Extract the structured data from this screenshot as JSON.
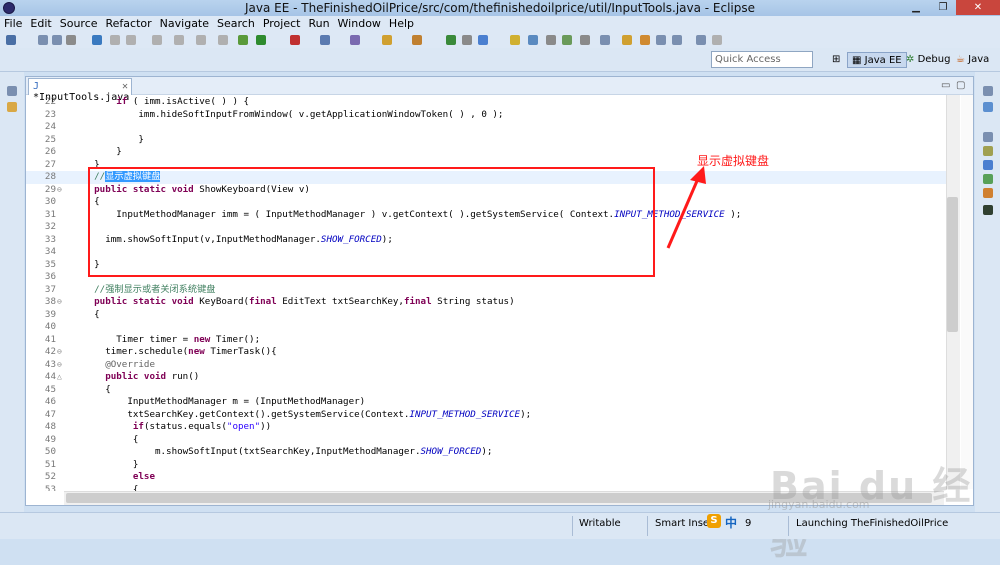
{
  "window": {
    "title": "Java EE - TheFinishedOilPrice/src/com/thefinishedoilprice/util/InputTools.java - Eclipse"
  },
  "menu": [
    "File",
    "Edit",
    "Source",
    "Refactor",
    "Navigate",
    "Search",
    "Project",
    "Run",
    "Window",
    "Help"
  ],
  "quick_access": {
    "placeholder": "Quick Access"
  },
  "perspectives": {
    "java_ee": "Java EE",
    "debug": "Debug",
    "java": "Java"
  },
  "editor": {
    "tab_label": "*InputTools.java"
  },
  "code_lines": [
    {
      "n": "22",
      "parts": [
        [
          "t",
          "        "
        ],
        [
          "kw",
          "if"
        ],
        [
          "t",
          " ( imm.isActive( ) ) {"
        ]
      ]
    },
    {
      "n": "23",
      "parts": [
        [
          "t",
          "            imm.hideSoftInputFromWindow( v.getApplicationWindowToken( ) , 0 );"
        ]
      ]
    },
    {
      "n": "24",
      "parts": [
        [
          "t",
          ""
        ]
      ]
    },
    {
      "n": "25",
      "parts": [
        [
          "t",
          "            }"
        ]
      ]
    },
    {
      "n": "26",
      "parts": [
        [
          "t",
          "        }"
        ]
      ]
    },
    {
      "n": "27",
      "parts": [
        [
          "t",
          "    }"
        ]
      ]
    },
    {
      "n": "28",
      "cur": true,
      "parts": [
        [
          "t",
          "    "
        ],
        [
          "cm",
          "//"
        ],
        [
          "hl",
          "显示虚拟键盘"
        ]
      ]
    },
    {
      "n": "29",
      "mk": "⊖",
      "parts": [
        [
          "t",
          "    "
        ],
        [
          "kw",
          "public static void"
        ],
        [
          "t",
          " ShowKeyboard(View v)"
        ]
      ]
    },
    {
      "n": "30",
      "parts": [
        [
          "t",
          "    {"
        ]
      ]
    },
    {
      "n": "31",
      "parts": [
        [
          "t",
          "        InputMethodManager imm = ( InputMethodManager ) v.getContext( ).getSystemService( Context."
        ],
        [
          "fi",
          "INPUT_METHOD_SERVICE"
        ],
        [
          "t",
          " );"
        ]
      ]
    },
    {
      "n": "32",
      "parts": [
        [
          "t",
          ""
        ]
      ]
    },
    {
      "n": "33",
      "parts": [
        [
          "t",
          "      imm.showSoftInput(v,InputMethodManager."
        ],
        [
          "fi",
          "SHOW_FORCED"
        ],
        [
          "t",
          ");"
        ]
      ]
    },
    {
      "n": "34",
      "parts": [
        [
          "t",
          ""
        ]
      ]
    },
    {
      "n": "35",
      "parts": [
        [
          "t",
          "    }"
        ]
      ]
    },
    {
      "n": "36",
      "parts": [
        [
          "t",
          ""
        ]
      ]
    },
    {
      "n": "37",
      "parts": [
        [
          "t",
          "    "
        ],
        [
          "cm",
          "//强制显示或者关闭系统键盘"
        ]
      ]
    },
    {
      "n": "38",
      "mk": "⊖",
      "parts": [
        [
          "t",
          "    "
        ],
        [
          "kw",
          "public static void"
        ],
        [
          "t",
          " KeyBoard("
        ],
        [
          "kw",
          "final"
        ],
        [
          "t",
          " EditText txtSearchKey,"
        ],
        [
          "kw",
          "final"
        ],
        [
          "t",
          " String status)"
        ]
      ]
    },
    {
      "n": "39",
      "parts": [
        [
          "t",
          "    {"
        ]
      ]
    },
    {
      "n": "40",
      "parts": [
        [
          "t",
          ""
        ]
      ]
    },
    {
      "n": "41",
      "parts": [
        [
          "t",
          "        Timer timer = "
        ],
        [
          "kw",
          "new"
        ],
        [
          "t",
          " Timer();"
        ]
      ]
    },
    {
      "n": "42",
      "mk": "⊖",
      "parts": [
        [
          "t",
          "      timer.schedule("
        ],
        [
          "kw",
          "new"
        ],
        [
          "t",
          " TimerTask(){"
        ]
      ]
    },
    {
      "n": "43",
      "mk": "⊖",
      "parts": [
        [
          "t",
          "      "
        ],
        [
          "an",
          "@Override"
        ]
      ]
    },
    {
      "n": "44",
      "mk": "△",
      "parts": [
        [
          "t",
          "      "
        ],
        [
          "kw",
          "public void"
        ],
        [
          "t",
          " run()"
        ]
      ]
    },
    {
      "n": "45",
      "parts": [
        [
          "t",
          "      {"
        ]
      ]
    },
    {
      "n": "46",
      "parts": [
        [
          "t",
          "          InputMethodManager m = (InputMethodManager)"
        ]
      ]
    },
    {
      "n": "47",
      "parts": [
        [
          "t",
          "          txtSearchKey.getContext().getSystemService(Context."
        ],
        [
          "fi",
          "INPUT_METHOD_SERVICE"
        ],
        [
          "t",
          ");"
        ]
      ]
    },
    {
      "n": "48",
      "parts": [
        [
          "t",
          "           "
        ],
        [
          "kw",
          "if"
        ],
        [
          "t",
          "(status.equals("
        ],
        [
          "st",
          "\"open\""
        ],
        [
          "t",
          "))"
        ]
      ]
    },
    {
      "n": "49",
      "parts": [
        [
          "t",
          "           {"
        ]
      ]
    },
    {
      "n": "50",
      "parts": [
        [
          "t",
          "               m.showSoftInput(txtSearchKey,InputMethodManager."
        ],
        [
          "fi",
          "SHOW_FORCED"
        ],
        [
          "t",
          ");"
        ]
      ]
    },
    {
      "n": "51",
      "parts": [
        [
          "t",
          "           }"
        ]
      ]
    },
    {
      "n": "52",
      "parts": [
        [
          "t",
          "           "
        ],
        [
          "kw",
          "else"
        ]
      ]
    },
    {
      "n": "53",
      "parts": [
        [
          "t",
          "           {"
        ]
      ]
    }
  ],
  "annotation": {
    "text": "显示虚拟键盘",
    "color": "#ff1a1a"
  },
  "status": {
    "writable": "Writable",
    "insert_mode": "Smart Insert",
    "position": "9",
    "progress": "Launching TheFinishedOilPrice",
    "ime": "中"
  },
  "watermark": {
    "brand": "Bai du 经验",
    "url": "jingyan.baidu.com"
  }
}
